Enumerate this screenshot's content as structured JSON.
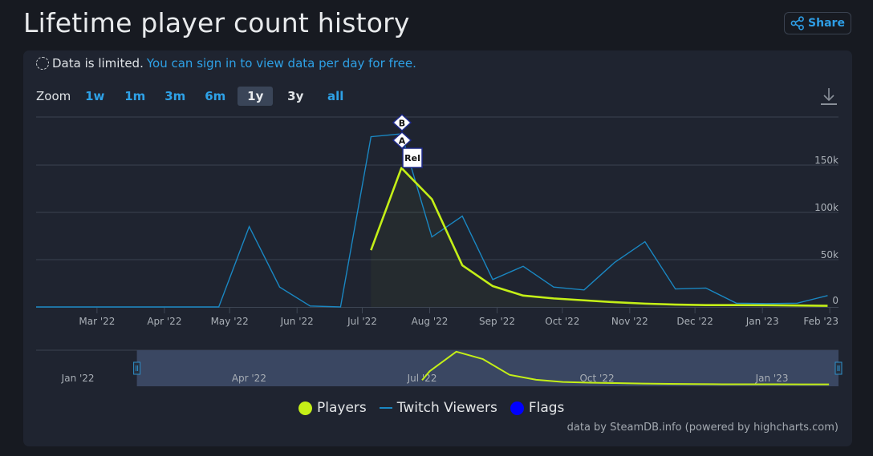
{
  "page": {
    "title": "Lifetime player count history",
    "share_label": "Share"
  },
  "notice": {
    "text": "Data is limited.",
    "link": "You can sign in to view data per day for free."
  },
  "zoom": {
    "label": "Zoom",
    "buttons": [
      {
        "label": "1w",
        "active": false
      },
      {
        "label": "1m",
        "active": false
      },
      {
        "label": "3m",
        "active": false
      },
      {
        "label": "6m",
        "active": false
      },
      {
        "label": "1y",
        "active": true
      },
      {
        "label": "3y",
        "active": false
      },
      {
        "label": "all",
        "active": false
      }
    ]
  },
  "legend": {
    "items": [
      {
        "label": "Players",
        "color": "#c4ef17",
        "symbol": "circle"
      },
      {
        "label": "Twitch Viewers",
        "color": "#1a87c2",
        "symbol": "line"
      },
      {
        "label": "Flags",
        "color": "#0000ff",
        "symbol": "circle"
      }
    ]
  },
  "credit": "data by SteamDB.info (powered by highcharts.com)",
  "chart_data": {
    "type": "line",
    "title": "Lifetime player count history",
    "xlabel": "",
    "ylabel": "",
    "ylim": [
      0,
      200000
    ],
    "yticks": [
      0,
      50000,
      100000,
      150000
    ],
    "ytick_labels": [
      "0",
      "50k",
      "100k",
      "150k"
    ],
    "xticks": [
      "Mar '22",
      "Apr '22",
      "May '22",
      "Jun '22",
      "Jul '22",
      "Aug '22",
      "Sep '22",
      "Oct '22",
      "Nov '22",
      "Dec '22",
      "Jan '23",
      "Feb '23"
    ],
    "grid": true,
    "legend_position": "bottom-center",
    "x_range": [
      "2022-02-01",
      "2023-02-05"
    ],
    "series": [
      {
        "name": "Twitch Viewers",
        "color": "#1a87c2",
        "points": [
          [
            "2022-02-01",
            0
          ],
          [
            "2022-02-15",
            0
          ],
          [
            "2022-03-01",
            0
          ],
          [
            "2022-03-15",
            0
          ],
          [
            "2022-03-29",
            0
          ],
          [
            "2022-04-12",
            0
          ],
          [
            "2022-04-26",
            0
          ],
          [
            "2022-05-10",
            85000
          ],
          [
            "2022-05-24",
            21000
          ],
          [
            "2022-06-07",
            1000
          ],
          [
            "2022-06-21",
            0
          ],
          [
            "2022-07-05",
            180000
          ],
          [
            "2022-07-19",
            183000
          ],
          [
            "2022-08-02",
            74000
          ],
          [
            "2022-08-16",
            96000
          ],
          [
            "2022-08-30",
            29000
          ],
          [
            "2022-09-13",
            43000
          ],
          [
            "2022-09-27",
            21000
          ],
          [
            "2022-10-11",
            18000
          ],
          [
            "2022-10-25",
            47000
          ],
          [
            "2022-11-08",
            69000
          ],
          [
            "2022-11-22",
            19000
          ],
          [
            "2022-12-06",
            20000
          ],
          [
            "2022-12-20",
            4000
          ],
          [
            "2023-01-03",
            3500
          ],
          [
            "2023-01-17",
            4000
          ],
          [
            "2023-01-31",
            12000
          ]
        ]
      },
      {
        "name": "Players",
        "color": "#c4ef17",
        "points": [
          [
            "2022-07-05",
            60000
          ],
          [
            "2022-07-19",
            147000
          ],
          [
            "2022-08-02",
            114000
          ],
          [
            "2022-08-16",
            44000
          ],
          [
            "2022-08-30",
            22000
          ],
          [
            "2022-09-13",
            12000
          ],
          [
            "2022-09-27",
            9000
          ],
          [
            "2022-10-11",
            7000
          ],
          [
            "2022-10-25",
            5000
          ],
          [
            "2022-11-08",
            3500
          ],
          [
            "2022-11-22",
            2500
          ],
          [
            "2022-12-06",
            2000
          ],
          [
            "2022-12-20",
            2000
          ],
          [
            "2023-01-03",
            1800
          ],
          [
            "2023-01-17",
            1500
          ],
          [
            "2023-01-31",
            1200
          ]
        ]
      }
    ],
    "flags": [
      {
        "label": "B",
        "date": "2022-07-20",
        "shape": "diamond"
      },
      {
        "label": "A",
        "date": "2022-07-20",
        "shape": "diamond"
      },
      {
        "label": "Rel",
        "date": "2022-07-21",
        "shape": "box"
      }
    ],
    "navigator": {
      "xticks": [
        "Jan '22",
        "Apr '22",
        "Jul '22",
        "Oct '22",
        "Jan '23"
      ],
      "selected_range": [
        "2022-02-01",
        "2023-02-05"
      ]
    }
  }
}
